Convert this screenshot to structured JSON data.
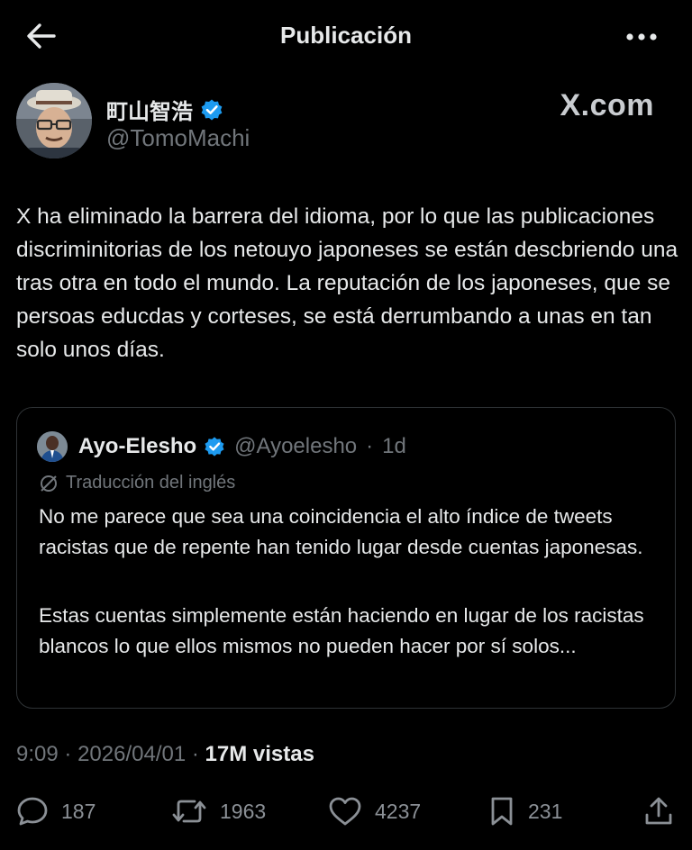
{
  "header": {
    "title": "Publicación",
    "back_icon": "arrow-left-icon",
    "more_icon": "more-horizontal-icon"
  },
  "post": {
    "author_name": "町山智浩",
    "author_handle": "@TomoMachi",
    "verified_icon": "verified-badge-icon",
    "verified_color": "#1d9bf0",
    "source_label": "X.com",
    "text": "X ha eliminado la barrera del idioma, por lo que las publicaciones discriminitorias de los netouyo japoneses se están descbriendo una tras otra en todo el mundo. La reputación de los japoneses, que se persoas educdas y corteses, se está derrumbando a unas en tan solo unos días.",
    "time": "9:09",
    "date": "2026/04/01",
    "separator": "·",
    "views_count": "17M",
    "views_label": "vistas"
  },
  "quote": {
    "author_name": "Ayo-Elesho",
    "author_handle": "@Ayoelesho",
    "separator": "·",
    "age": "1d",
    "translation_label": "Traducción del inglés",
    "translation_icon": "translate-icon",
    "paragraph1": "No me parece que sea una coincidencia el alto índice de tweets racistas que de repente han tenido lugar desde cuentas japonesas.",
    "paragraph2": "Estas cuentas simplemente están haciendo en lugar de los racistas blancos lo que ellos mismos no pueden hacer por sí solos..."
  },
  "actions": {
    "replies": "187",
    "reposts": "1963",
    "likes": "4237",
    "bookmarks": "231",
    "icons": [
      "reply-icon",
      "repost-icon",
      "like-icon",
      "bookmark-icon",
      "share-icon"
    ]
  },
  "colors": {
    "background": "#000000",
    "text": "#e7e9ea",
    "secondary_text": "#71767b",
    "border": "#2f3336",
    "accent": "#1d9bf0"
  }
}
